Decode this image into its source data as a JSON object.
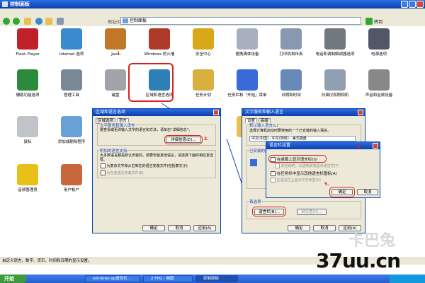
{
  "window": {
    "title": "控制面板"
  },
  "toolbar": {
    "address_label": "地址(D)",
    "address_value": "控制面板",
    "go_label": "转到"
  },
  "step_labels": {
    "s1": "1.",
    "s2": "2.",
    "s4": "4.",
    "s5": "5."
  },
  "applets": [
    {
      "label": "Flash Player",
      "icon": "flash-icon",
      "color": "#c0202a"
    },
    {
      "label": "Internet 选项",
      "icon": "internet-globe-icon",
      "color": "#3a8ad0"
    },
    {
      "label": "Java",
      "icon": "java-icon",
      "color": "#c07828"
    },
    {
      "label": "Windows 防火墙",
      "icon": "firewall-icon",
      "color": "#b03a2a"
    },
    {
      "label": "安全中心",
      "icon": "shield-icon",
      "color": "#d8a818"
    },
    {
      "label": "便携媒体设备",
      "icon": "portable-device-icon",
      "color": "#a8b0c0"
    },
    {
      "label": "打印机和传真",
      "icon": "printer-icon",
      "color": "#8898b0"
    },
    {
      "label": "电话和调制解调器选项",
      "icon": "phone-modem-icon",
      "color": "#707880"
    },
    {
      "label": "电源选项",
      "icon": "power-icon",
      "color": "#505868"
    },
    {
      "label": "辅助功能选项",
      "icon": "accessibility-icon",
      "color": "#2c8a3c"
    },
    {
      "label": "管理工具",
      "icon": "admin-tools-icon",
      "color": "#7a8898"
    },
    {
      "label": "键盘",
      "icon": "keyboard-icon",
      "color": "#a0a4a8"
    },
    {
      "label": "区域和语言选项",
      "icon": "region-globe-icon",
      "color": "#2e7fb8"
    },
    {
      "label": "任务计划",
      "icon": "scheduled-tasks-icon",
      "color": "#d8b040"
    },
    {
      "label": "任务栏和「开始」菜单",
      "icon": "taskbar-icon",
      "color": "#3a6ad8"
    },
    {
      "label": "日期和时间",
      "icon": "clock-icon",
      "color": "#6888b8"
    },
    {
      "label": "扫描仪和照相机",
      "icon": "scanner-icon",
      "color": "#90a0b0"
    },
    {
      "label": "声音和音频设备",
      "icon": "speaker-icon",
      "color": "#888888"
    },
    {
      "label": "鼠标",
      "icon": "mouse-icon",
      "color": "#c0c4c8"
    },
    {
      "label": "添加或删除程序",
      "icon": "add-remove-icon",
      "color": "#6aa0d8"
    },
    {
      "label": "文件夹",
      "icon": "folder-icon",
      "color": "#e8c050"
    },
    {
      "label": "音频管理员",
      "icon": "audio-manager-icon",
      "color": "#e8c018"
    },
    {
      "label": "用户帐户",
      "icon": "users-icon",
      "color": "#c8683a"
    }
  ],
  "dialog1": {
    "title": "区域和语言选项",
    "tabs": [
      "区域选项",
      "语言"
    ],
    "group1_title": "文字服务和输入语言",
    "group1_text": "要查看或更改输入文字的语言和方法，请单击“详细信息”。",
    "details_btn": "详细信息(D)...",
    "group2_title": "附加的语言支持",
    "group2_text": "大多数语言都是默认安装的。若要安装其他语言，请选择下面的相应复选框。",
    "check1": "为复杂文字和从右到左的语言安装文件(包括泰文)(I)",
    "check2": "为东亚语言安装文件(E)",
    "ok": "确定",
    "cancel": "取消",
    "apply": "应用(A)"
  },
  "dialog2": {
    "title": "文字服务和输入语言",
    "tabs": [
      "设置",
      "高级"
    ],
    "default_group": "默认输入语言(L)",
    "default_text": "选择计算机启动时要使用的一个已安装的输入语言。",
    "default_value": "中文(中国) - 中文(简体) - 美式键盘",
    "installed_group": "已安装的服务",
    "prefs_group": "首选项",
    "langbar_btn": "语言栏(B)...",
    "keys_btn": "键设置(K)...",
    "ok": "确定",
    "cancel": "取消",
    "apply": "应用(A)"
  },
  "dialog3": {
    "title": "语言栏设置",
    "opt1": "在桌面上显示语言栏(S)",
    "opt2": "非活动时，以透明状态显示语言栏(T)",
    "opt3": "在任务栏中显示其他语言栏图标(A)",
    "opt4": "在语言栏上显示文字标签(X)",
    "ok": "确定",
    "cancel": "取消"
  },
  "status": {
    "text": "自定义语言、数字、货币、时间和日期的显示设置。"
  },
  "taskbar": {
    "start": "开始",
    "tasks": [
      "windows xp语言栏...",
      "2 FPG - 画图",
      "控制面板"
    ]
  },
  "watermark": {
    "text": "37uu.cn",
    "ghost": "卡巴兔"
  }
}
